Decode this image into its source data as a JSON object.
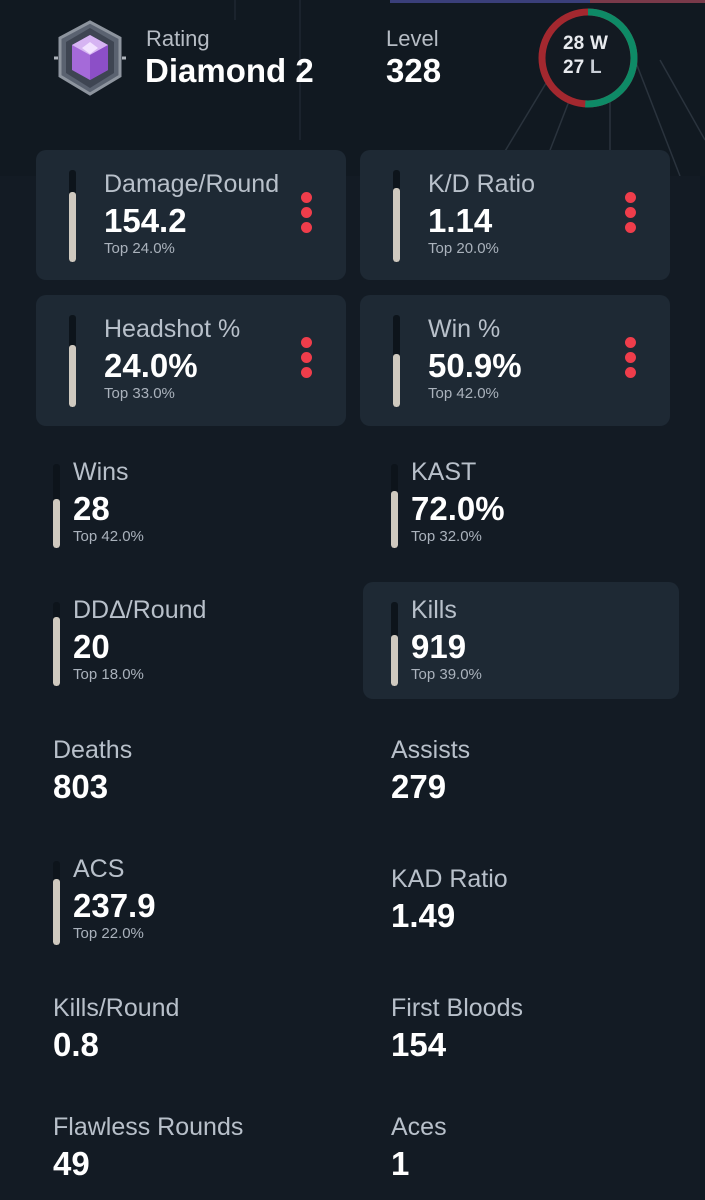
{
  "profile": {
    "rating_label": "Rating",
    "rating_value": "Diamond 2",
    "level_label": "Level",
    "level_value": "328",
    "wins_count": "28",
    "wins_letter": "W",
    "losses_count": "27",
    "losses_letter": "L",
    "win_fraction": 0.509
  },
  "colors": {
    "win": "#0e8a66",
    "loss": "#a3282f",
    "more_dots": "#ef3d4b",
    "bar_fill": "#cfc9bf"
  },
  "icons": {
    "rank": "diamond-rank-icon",
    "more": "more-vertical-icon"
  },
  "stats": {
    "damage_round": {
      "label": "Damage/Round",
      "value": "154.2",
      "top": "Top 24.0%",
      "percentile": 0.76
    },
    "kd_ratio": {
      "label": "K/D Ratio",
      "value": "1.14",
      "top": "Top 20.0%",
      "percentile": 0.8
    },
    "headshot": {
      "label": "Headshot %",
      "value": "24.0%",
      "top": "Top 33.0%",
      "percentile": 0.67
    },
    "win_pct": {
      "label": "Win %",
      "value": "50.9%",
      "top": "Top 42.0%",
      "percentile": 0.58
    },
    "wins": {
      "label": "Wins",
      "value": "28",
      "top": "Top 42.0%",
      "percentile": 0.58
    },
    "kast": {
      "label": "KAST",
      "value": "72.0%",
      "top": "Top 32.0%",
      "percentile": 0.68
    },
    "dda_round": {
      "label": "DDΔ/Round",
      "value": "20",
      "top": "Top 18.0%",
      "percentile": 0.82
    },
    "kills": {
      "label": "Kills",
      "value": "919",
      "top": "Top 39.0%",
      "percentile": 0.61
    },
    "deaths": {
      "label": "Deaths",
      "value": "803"
    },
    "assists": {
      "label": "Assists",
      "value": "279"
    },
    "acs": {
      "label": "ACS",
      "value": "237.9",
      "top": "Top 22.0%",
      "percentile": 0.78
    },
    "kad_ratio": {
      "label": "KAD Ratio",
      "value": "1.49"
    },
    "kills_round": {
      "label": "Kills/Round",
      "value": "0.8"
    },
    "first_bloods": {
      "label": "First Bloods",
      "value": "154"
    },
    "flawless": {
      "label": "Flawless Rounds",
      "value": "49"
    },
    "aces": {
      "label": "Aces",
      "value": "1"
    }
  }
}
